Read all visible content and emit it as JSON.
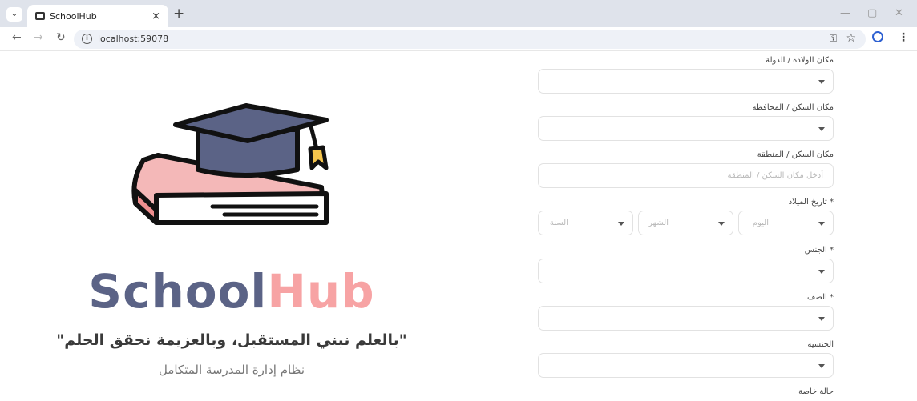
{
  "browser": {
    "tab_title": "SchoolHub",
    "url": "localhost:59078",
    "new_tab": "+",
    "tab_close": "×"
  },
  "brand": {
    "name_a": "School",
    "name_b": "Hub",
    "color_a": "#5b6386",
    "color_b": "#f7a3a4",
    "motto": "\"بالعلم نبني المستقبل، وبالعزيمة نحقق الحلم\"",
    "subtitle": "نظام إدارة المدرسة المتكامل"
  },
  "form": {
    "birth_place": {
      "label": "مكان الولادة / الدولة",
      "value": ""
    },
    "residence_province": {
      "label": "مكان السكن / المحافظة",
      "value": ""
    },
    "residence_area": {
      "label": "مكان السكن / المنطقة",
      "placeholder": "أدخل مكان السكن / المنطقة"
    },
    "birth_date": {
      "label": "* تاريخ الميلاد",
      "day": "اليوم",
      "month": "الشهر",
      "year": "السنة"
    },
    "gender": {
      "label": "* الجنس",
      "value": ""
    },
    "grade": {
      "label": "* الصف",
      "value": ""
    },
    "nationality": {
      "label": "الجنسية",
      "value": ""
    },
    "special_status": {
      "label": "حالة خاصة"
    }
  }
}
